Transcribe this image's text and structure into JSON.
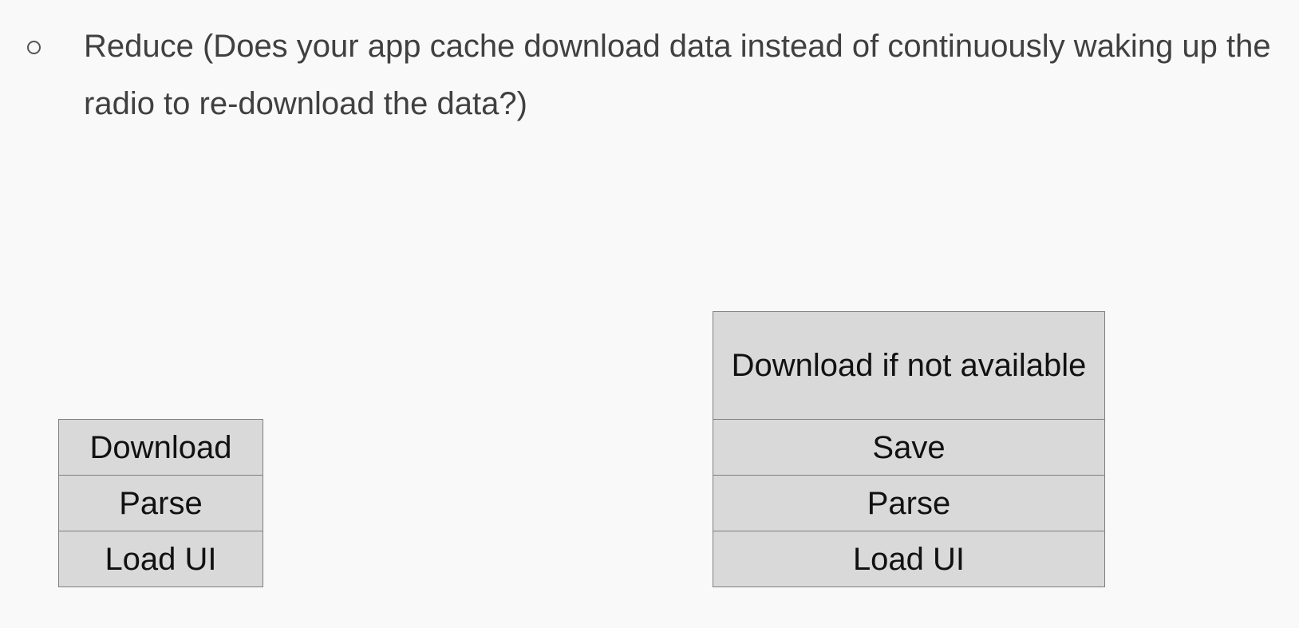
{
  "bullet": {
    "text": "Reduce (Does your app cache download data instead of continuously waking up the radio to re-download the data?)",
    "icon": "hollow-circle-bullet-icon"
  },
  "left_stack": {
    "steps": [
      {
        "label": "Download"
      },
      {
        "label": "Parse"
      },
      {
        "label": "Load UI"
      }
    ]
  },
  "right_stack": {
    "steps": [
      {
        "label": "Download if not available"
      },
      {
        "label": "Save"
      },
      {
        "label": "Parse"
      },
      {
        "label": "Load UI"
      }
    ]
  },
  "colors": {
    "background": "#f9f9f9",
    "box_fill": "#d9d9d9",
    "box_border": "#7f7f7f",
    "text": "#404040"
  }
}
